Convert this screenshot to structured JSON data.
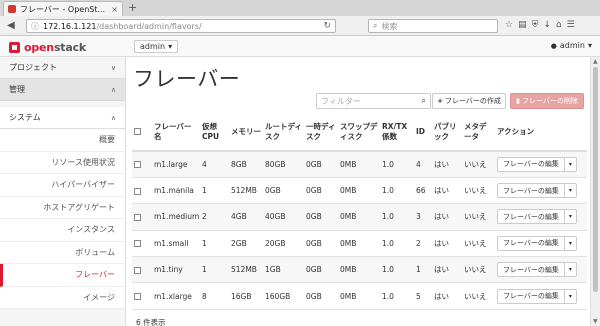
{
  "browser": {
    "tab_title": "フレーバー - OpenSt...",
    "tab_close": "×",
    "new_tab": "+",
    "url_host": "172.16.1.121",
    "url_path": "/dashboard/admin/flavors/",
    "reload": "↻",
    "search_placeholder": "検索",
    "back": "◀",
    "toolbar_icons": {
      "star": "☆",
      "reader": "▤",
      "shield": "⛨",
      "download": "↓",
      "home": "⌂",
      "menu": "☰"
    }
  },
  "header": {
    "logo_red": "open",
    "logo_dark": "stack",
    "project": "admin",
    "project_caret": "▾",
    "user": "admin",
    "user_caret": "▾",
    "user_icon": "👤"
  },
  "sidebar": {
    "project": {
      "label": "プロジェクト",
      "chevron": "∨"
    },
    "admin": {
      "label": "管理",
      "chevron": "∧"
    },
    "system": {
      "label": "システム",
      "chevron": "∧"
    },
    "items": [
      {
        "label": "概要"
      },
      {
        "label": "リソース使用状況"
      },
      {
        "label": "ハイパーバイザー"
      },
      {
        "label": "ホストアグリゲート"
      },
      {
        "label": "インスタンス"
      },
      {
        "label": "ボリューム"
      },
      {
        "label": "フレーバー",
        "active": true
      },
      {
        "label": "イメージ"
      }
    ]
  },
  "main": {
    "title": "フレーバー",
    "filter_placeholder": "フィルター",
    "filter_icon": "🔍",
    "create_icon": "+",
    "create_label": "フレーバーの作成",
    "delete_icon": "🗑",
    "delete_label": "フレーバーの削除",
    "columns": [
      "フレーバー名",
      "仮想CPU",
      "メモリー",
      "ルートディスク",
      "一時ディスク",
      "スワップディスク",
      "RX/TX係数",
      "ID",
      "パブリック",
      "メタデータ",
      "アクション"
    ],
    "rows": [
      {
        "name": "m1.large",
        "vcpu": "4",
        "ram": "8GB",
        "root": "80GB",
        "eph": "0GB",
        "swap": "0MB",
        "rxtx": "1.0",
        "id": "4",
        "public": "はい",
        "meta": "いいえ",
        "action": "フレーバーの編集"
      },
      {
        "name": "m1.manila",
        "vcpu": "1",
        "ram": "512MB",
        "root": "0GB",
        "eph": "0GB",
        "swap": "0MB",
        "rxtx": "1.0",
        "id": "66",
        "public": "はい",
        "meta": "いいえ",
        "action": "フレーバーの編集"
      },
      {
        "name": "m1.medium",
        "vcpu": "2",
        "ram": "4GB",
        "root": "40GB",
        "eph": "0GB",
        "swap": "0MB",
        "rxtx": "1.0",
        "id": "3",
        "public": "はい",
        "meta": "いいえ",
        "action": "フレーバーの編集"
      },
      {
        "name": "m1.small",
        "vcpu": "1",
        "ram": "2GB",
        "root": "20GB",
        "eph": "0GB",
        "swap": "0MB",
        "rxtx": "1.0",
        "id": "2",
        "public": "はい",
        "meta": "いいえ",
        "action": "フレーバーの編集"
      },
      {
        "name": "m1.tiny",
        "vcpu": "1",
        "ram": "512MB",
        "root": "1GB",
        "eph": "0GB",
        "swap": "0MB",
        "rxtx": "1.0",
        "id": "1",
        "public": "はい",
        "meta": "いいえ",
        "action": "フレーバーの編集"
      },
      {
        "name": "m1.xlarge",
        "vcpu": "8",
        "ram": "16GB",
        "root": "160GB",
        "eph": "0GB",
        "swap": "0MB",
        "rxtx": "1.0",
        "id": "5",
        "public": "はい",
        "meta": "いいえ",
        "action": "フレーバーの編集"
      }
    ],
    "action_caret": "▾",
    "count_label": "6 件表示"
  },
  "colors": {
    "brand": "#da1a32",
    "link": "#1a7ac7",
    "delete_bg": "#e8a3a3"
  }
}
